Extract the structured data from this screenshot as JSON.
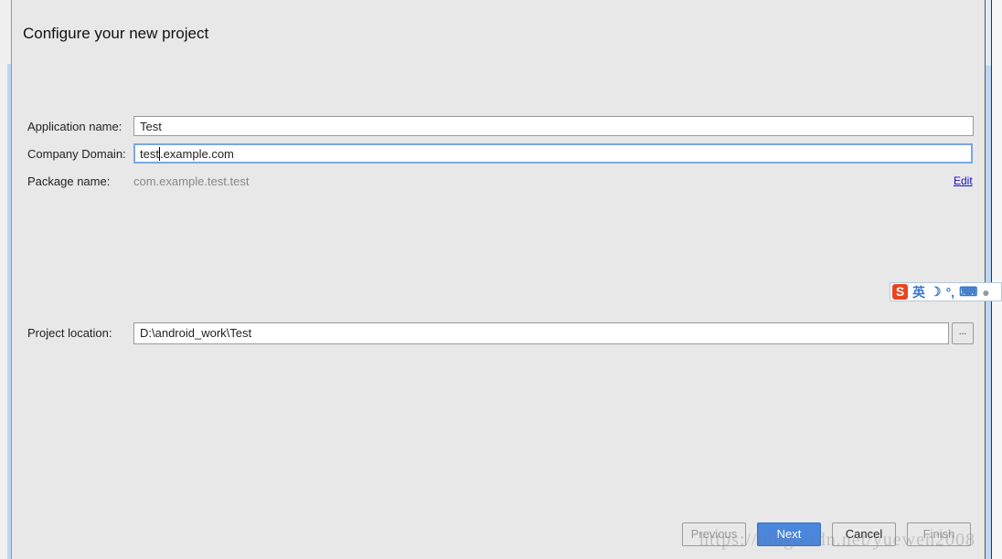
{
  "title": "Configure your new project",
  "fields": {
    "app_name": {
      "label": "Application name:",
      "value": "Test"
    },
    "company_domain": {
      "label": "Company Domain:",
      "value_before_caret": "test",
      "value_after_caret": ".example.com"
    },
    "package_name": {
      "label": "Package name:",
      "value": "com.example.test.test",
      "edit": "Edit"
    },
    "project_location": {
      "label": "Project location:",
      "value": "D:\\android_work\\Test",
      "browse": "..."
    }
  },
  "ime_toolbar": {
    "logo": "S",
    "mode": "英",
    "punct": "°,"
  },
  "buttons": {
    "previous": "Previous",
    "next": "Next",
    "cancel": "Cancel",
    "finish": "Finish"
  },
  "watermark": "https://blog.csdn.net/yuewen2008"
}
